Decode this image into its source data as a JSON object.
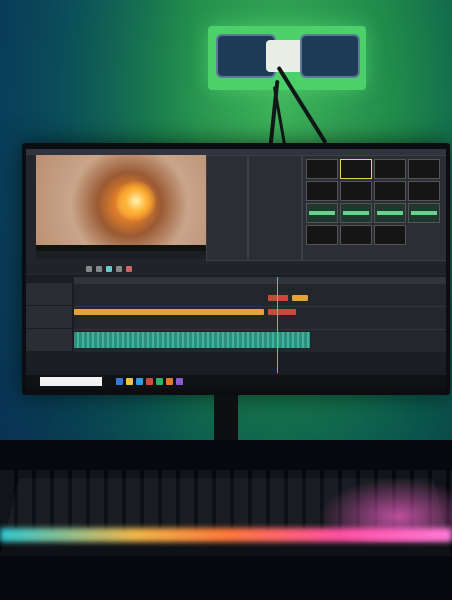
{
  "scene": {
    "description_colors": {
      "wall_glow": "#3fb35a",
      "keyboard_glow_left": "#2ec7d0",
      "keyboard_glow_mid": "#ff7a3a",
      "keyboard_glow_right": "#ff4fa3",
      "playhead": "#4fb8ff",
      "audio_clip": "#3fb39c",
      "video_clip": "#e3a23a"
    }
  },
  "taskbar": {
    "search_placeholder": "",
    "tray_text": ""
  }
}
